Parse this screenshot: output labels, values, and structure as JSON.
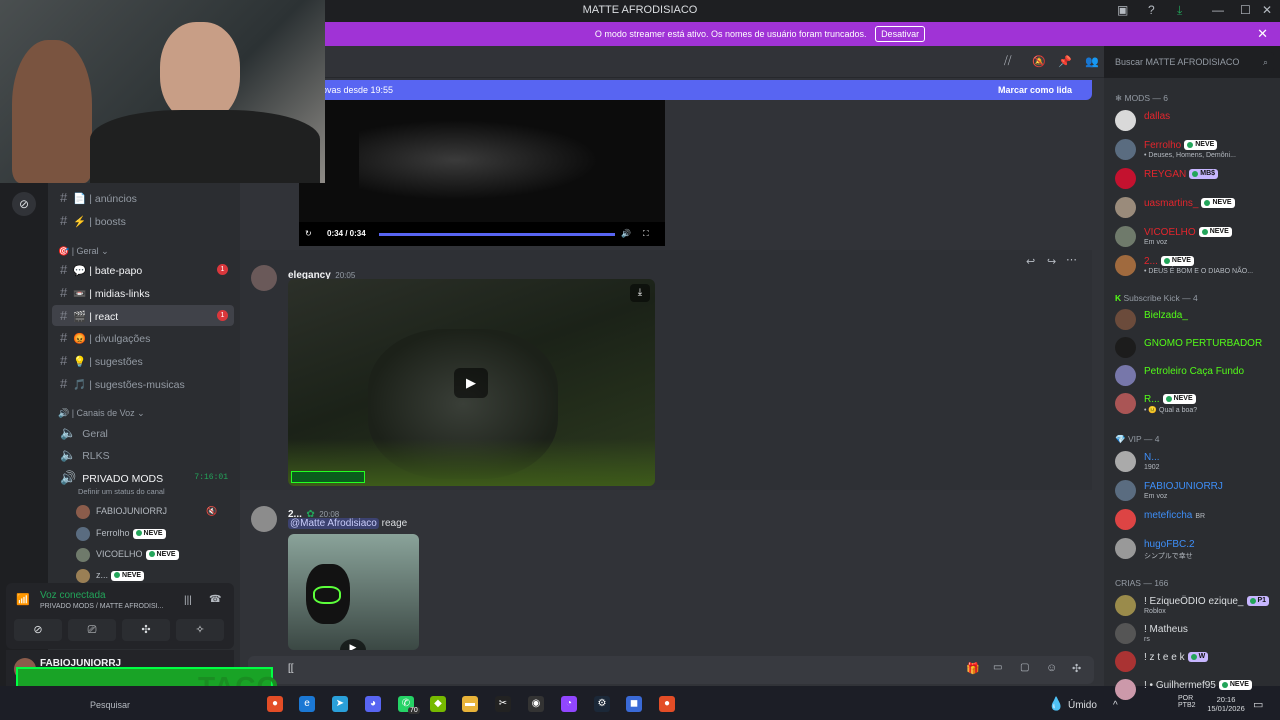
{
  "titlebar": {
    "title": "MATTE AFRODISIACO"
  },
  "banner": {
    "text": "O modo streamer está ativo. Os nomes de usuário foram truncados.",
    "button": "Desativar"
  },
  "header": {
    "search_placeholder": "Buscar MATTE AFRODISIACO"
  },
  "new_messages": {
    "text": "ovas desde 19:55",
    "action": "Marcar como lida"
  },
  "channels": {
    "top": [
      {
        "icon": "📄",
        "label": "| anúncios"
      },
      {
        "icon": "⚡",
        "label": "| boosts"
      }
    ],
    "category_geral": "| Geral",
    "geral_items": [
      {
        "icon": "💬",
        "label": "| bate-papo",
        "badge": "1"
      },
      {
        "icon": "📼",
        "label": "| midias-links"
      },
      {
        "icon": "🎬",
        "label": "| react",
        "badge": "1"
      },
      {
        "icon": "😡",
        "label": "| divulgações"
      },
      {
        "icon": "💡",
        "label": "| sugestões"
      },
      {
        "icon": "🎵",
        "label": "| sugestões-musicas"
      }
    ],
    "category_voice": "| Canais de Voz",
    "voice_channels": [
      "Geral",
      "RLKS",
      "PRIVADO MODS"
    ],
    "voice_timer": "7:16:01",
    "voice_status": "Definir um status do canal",
    "voice_users": [
      {
        "name": "FABIOJUNIORRJ"
      },
      {
        "name": "Ferrolho",
        "tag": "NEVE"
      },
      {
        "name": "VICOELHO",
        "tag": "NEVE"
      },
      {
        "name": "z...",
        "tag": "NEVE"
      }
    ]
  },
  "voice_panel": {
    "title": "Voz conectada",
    "subtitle": "PRIVADO MODS / MATTE AFRODISI..."
  },
  "user_panel": {
    "name": "FABIOJUNIORRJ"
  },
  "messages": {
    "video1": {
      "time": "0:34 / 0:34",
      "progress": 1.0
    },
    "msg1": {
      "author": "elegancy",
      "time": "20:05"
    },
    "msg2": {
      "author": "2...",
      "time": "20:08",
      "mention": "@Matte Afrodisiaco",
      "text": "reage"
    }
  },
  "composer": {
    "value": "[["
  },
  "members": {
    "mods_header": "MODS — 6",
    "mods": [
      {
        "name": "dallas",
        "color": "#e3262d"
      },
      {
        "name": "Ferrolho",
        "color": "#e3262d",
        "tag": "NEVE",
        "status": "• Deuses, Homens, Demôni..."
      },
      {
        "name": "REYGAN",
        "color": "#e3262d",
        "tag2": "MB$"
      },
      {
        "name": "uasmartins_",
        "color": "#e3262d",
        "tag": "NEVE"
      },
      {
        "name": "VICOELHO",
        "color": "#e3262d",
        "tag": "NEVE",
        "status": "Em voz"
      },
      {
        "name": "2...",
        "color": "#e3262d",
        "tag": "NEVE",
        "status": "• DEUS É BOM E O DIABO NÃO..."
      }
    ],
    "kick_header": "Subscribe Kick — 4",
    "kick": [
      {
        "name": "Bielzada_",
        "color": "#53fc18"
      },
      {
        "name": "GNOMO PERTURBADOR",
        "color": "#53fc18"
      },
      {
        "name": "Petroleiro Caça Fundo",
        "color": "#53fc18"
      },
      {
        "name": "R...",
        "color": "#53fc18",
        "tag": "NEVE",
        "status": "• 😐 Qual a boa?"
      }
    ],
    "vip_header": "VIP — 4",
    "vip": [
      {
        "name": "N...",
        "color": "#3e8ef7",
        "status": "1902"
      },
      {
        "name": "FABIOJUNIORRJ",
        "color": "#3e8ef7",
        "status": "Em voz"
      },
      {
        "name": "meteficcha",
        "color": "#3e8ef7",
        "extra": "BR"
      },
      {
        "name": "hugoFBC.2",
        "color": "#3e8ef7",
        "status": "シンプルで幸せ"
      }
    ],
    "crias_header": "CRIAS — 166",
    "crias": [
      {
        "name": "! EziqueÖDIO ezique_",
        "color": "#dbdee1",
        "tag2": "P1",
        "status": "Roblox"
      },
      {
        "name": "! Matheus",
        "color": "#dbdee1",
        "status": "rs"
      },
      {
        "name": "! z t e e k",
        "color": "#dbdee1",
        "tag2": "W"
      },
      {
        "name": "! • Guilhermef95",
        "color": "#dbdee1",
        "tag": "NEVE"
      }
    ]
  },
  "taskbar": {
    "search": "Pesquisar",
    "weather": "Úmido",
    "lang": "POR",
    "lang2": "PTB2",
    "time": "20:16",
    "date": "15/01/2026",
    "whatsapp_badge": "70"
  },
  "overlay": {
    "text": "TACO"
  }
}
